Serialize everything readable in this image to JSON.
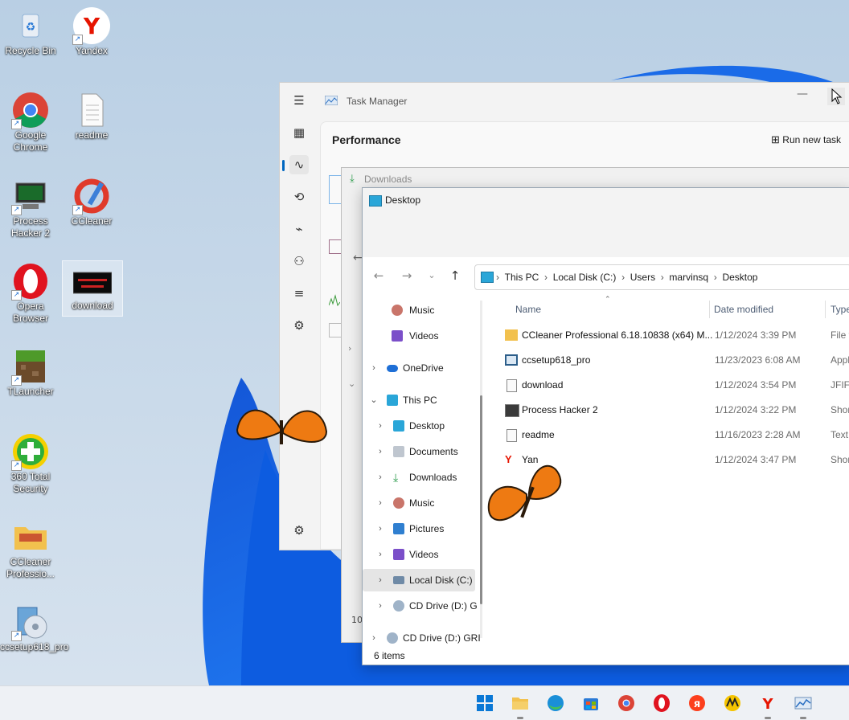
{
  "desktop": {
    "icons": [
      {
        "label": "Recycle Bin"
      },
      {
        "label": "Yandex"
      },
      {
        "label": "Google Chrome"
      },
      {
        "label": "readme"
      },
      {
        "label": "Process Hacker 2"
      },
      {
        "label": "CCleaner"
      },
      {
        "label": "Opera Browser"
      },
      {
        "label": "download"
      },
      {
        "label": "TLauncher"
      },
      {
        "label": "360 Total Security"
      },
      {
        "label": "CCleaner Professio..."
      },
      {
        "label": "ccsetup618_pro"
      }
    ]
  },
  "task_manager": {
    "title": "Task Manager",
    "page": "Performance",
    "run_new_task": "Run new task",
    "partial_numbers": [
      "10",
      "10"
    ]
  },
  "downloads_window": {
    "title": "Downloads"
  },
  "explorer": {
    "title": "Desktop",
    "breadcrumb": [
      "This PC",
      "Local Disk (C:)",
      "Users",
      "marvinsq",
      "Desktop"
    ],
    "nav": [
      {
        "label": "Music"
      },
      {
        "label": "Videos"
      },
      {
        "label": "OneDrive"
      },
      {
        "label": "This PC"
      },
      {
        "label": "Desktop"
      },
      {
        "label": "Documents"
      },
      {
        "label": "Downloads"
      },
      {
        "label": "Music"
      },
      {
        "label": "Pictures"
      },
      {
        "label": "Videos"
      },
      {
        "label": "Local Disk (C:)"
      },
      {
        "label": "CD Drive (D:) G"
      },
      {
        "label": "CD Drive (D:) GRI"
      }
    ],
    "columns": {
      "name": "Name",
      "date": "Date modified",
      "type": "Type"
    },
    "files": [
      {
        "name": "CCleaner Professional 6.18.10838 (x64) M...",
        "date": "1/12/2024 3:39 PM",
        "type": "File f"
      },
      {
        "name": "ccsetup618_pro",
        "date": "11/23/2023 6:08 AM",
        "type": "Appl"
      },
      {
        "name": "download",
        "date": "1/12/2024 3:54 PM",
        "type": "JFIF I"
      },
      {
        "name": "Process Hacker 2",
        "date": "1/12/2024 3:22 PM",
        "type": "Shor"
      },
      {
        "name": "readme",
        "date": "11/16/2023 2:28 AM",
        "type": "Text"
      },
      {
        "name": "Yan",
        "date": "1/12/2024 3:47 PM",
        "type": "Shor"
      }
    ],
    "status": "6 items"
  },
  "taskbar": {
    "apps": [
      "start",
      "file-explorer",
      "edge",
      "store",
      "chrome",
      "opera",
      "yandex-browser",
      "ccleaner-like",
      "yandex",
      "task-manager"
    ]
  },
  "colors": {
    "accent": "#0067c0",
    "taskbar": "#eef1f5"
  }
}
